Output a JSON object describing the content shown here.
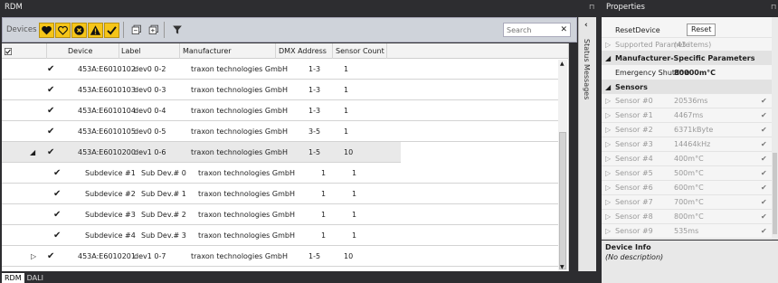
{
  "rdm": {
    "title": "RDM",
    "pin": "⊓",
    "toolbar": {
      "devices_label": "Devices",
      "search_placeholder": "Search"
    },
    "columns": [
      "Device",
      "Label",
      "Manufacturer",
      "DMX Address",
      "Sensor Count"
    ],
    "rows": [
      {
        "device": "453A:E6010102",
        "label": "dev0 0-2",
        "manufacturer": "traxon technologies GmbH",
        "dmx": "1-3",
        "sensors": "1",
        "kind": "device"
      },
      {
        "device": "453A:E6010103",
        "label": "dev0 0-3",
        "manufacturer": "traxon technologies GmbH",
        "dmx": "1-3",
        "sensors": "1",
        "kind": "device"
      },
      {
        "device": "453A:E6010104",
        "label": "dev0 0-4",
        "manufacturer": "traxon technologies GmbH",
        "dmx": "1-3",
        "sensors": "1",
        "kind": "device"
      },
      {
        "device": "453A:E6010105",
        "label": "dev0 0-5",
        "manufacturer": "traxon technologies GmbH",
        "dmx": "3-5",
        "sensors": "1",
        "kind": "device"
      },
      {
        "device": "453A:E6010200",
        "label": "dev1 0-6",
        "manufacturer": "traxon technologies GmbH",
        "dmx": "1-5",
        "sensors": "10",
        "kind": "device-expanded"
      },
      {
        "device": "Subdevice #1",
        "label": "Sub Dev.# 0",
        "manufacturer": "traxon technologies GmbH",
        "dmx": "1",
        "sensors": "1",
        "kind": "sub"
      },
      {
        "device": "Subdevice #2",
        "label": "Sub Dev.# 1",
        "manufacturer": "traxon technologies GmbH",
        "dmx": "1",
        "sensors": "1",
        "kind": "sub"
      },
      {
        "device": "Subdevice #3",
        "label": "Sub Dev.# 2",
        "manufacturer": "traxon technologies GmbH",
        "dmx": "1",
        "sensors": "1",
        "kind": "sub"
      },
      {
        "device": "Subdevice #4",
        "label": "Sub Dev.# 3",
        "manufacturer": "traxon technologies GmbH",
        "dmx": "1",
        "sensors": "1",
        "kind": "sub"
      },
      {
        "device": "453A:E6010201",
        "label": "dev1 0-7",
        "manufacturer": "traxon technologies GmbH",
        "dmx": "1-5",
        "sensors": "10",
        "kind": "device-collapsed"
      }
    ],
    "status_messages": "Status Messages",
    "tabs": [
      "RDM",
      "DALI"
    ]
  },
  "properties": {
    "title": "Properties",
    "pin": "⊓",
    "reset_device": {
      "name": "ResetDevice",
      "button": "Reset"
    },
    "supported_parameters": {
      "name": "Supported Paramete",
      "value": "(43 items)"
    },
    "manufacturer_category": "Manufacturer-Specific Parameters",
    "emergency": {
      "name": "Emergency Shutdow",
      "value": "80000m°C"
    },
    "sensors_category": "Sensors",
    "sensors": [
      {
        "name": "Sensor #0",
        "value": "20536ms"
      },
      {
        "name": "Sensor #1",
        "value": "4467ms"
      },
      {
        "name": "Sensor #2",
        "value": "6371kByte"
      },
      {
        "name": "Sensor #3",
        "value": "14464kHz"
      },
      {
        "name": "Sensor #4",
        "value": "400m°C"
      },
      {
        "name": "Sensor #5",
        "value": "500m°C"
      },
      {
        "name": "Sensor #6",
        "value": "600m°C"
      },
      {
        "name": "Sensor #7",
        "value": "700m°C"
      },
      {
        "name": "Sensor #8",
        "value": "800m°C"
      },
      {
        "name": "Sensor #9",
        "value": "535ms"
      }
    ],
    "device_info_title": "Device Info",
    "device_info_desc": "(No description)"
  }
}
